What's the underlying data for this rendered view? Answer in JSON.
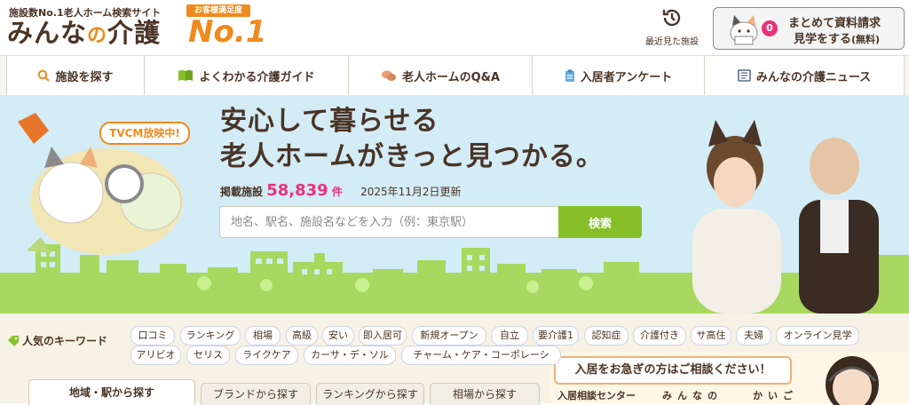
{
  "header": {
    "tagline": "施設数No.1老人ホーム検索サイト",
    "logo_pre": "みんな",
    "logo_no": "の",
    "logo_post": "介護",
    "satisfaction": "お客様満足度",
    "no1": "No.1",
    "history_label": "最近見た施設",
    "cta_count": "0",
    "cta_line1": "まとめて資料請求",
    "cta_line2": "見学をする",
    "cta_free": "(無料)"
  },
  "nav": {
    "items": [
      {
        "label": "施設を探す",
        "icon": "search-icon"
      },
      {
        "label": "よくわかる介護ガイド",
        "icon": "book-icon"
      },
      {
        "label": "老人ホームのQ&A",
        "icon": "chat-icon"
      },
      {
        "label": "入居者アンケート",
        "icon": "clipboard-icon"
      },
      {
        "label": "みんなの介護ニュース",
        "icon": "newspaper-icon"
      }
    ]
  },
  "hero": {
    "tvcm": "TVCM放映中!",
    "headline1": "安心して暮らせる",
    "headline2": "老人ホームがきっと見つかる。",
    "count_label": "掲載施設",
    "count_value": "58,839",
    "count_unit": "件",
    "updated": "2025年11月2日更新",
    "search_placeholder": "地名、駅名、施設名などを入力（例：東京駅）",
    "search_button": "検索"
  },
  "keywords": {
    "label": "人気のキーワード",
    "row1": [
      "口コミ",
      "ランキング",
      "相場",
      "高級",
      "安い",
      "即入居可",
      "新規オープン",
      "自立",
      "要介護1",
      "認知症",
      "介護付き",
      "サ高住",
      "夫婦",
      "オンライン見学"
    ],
    "row2": [
      "アリビオ",
      "セリス",
      "ライクケア",
      "カーサ・デ・ソル",
      "チャーム・ケア・コーポレーシ"
    ]
  },
  "tabs": [
    "地域・駅から探す",
    "ブランドから探す",
    "ランキングから探す",
    "相場から探す"
  ],
  "consult": {
    "bubble": "入居をお急ぎの方はご相談ください！",
    "center": "入居相談センター",
    "name1": "みんなの",
    "name2": "かいご"
  },
  "colors": {
    "accent": "#f08a1c",
    "pink": "#e8327a",
    "green": "#86bf2a",
    "brown": "#4a3426",
    "sky": "#d3ecf6"
  }
}
